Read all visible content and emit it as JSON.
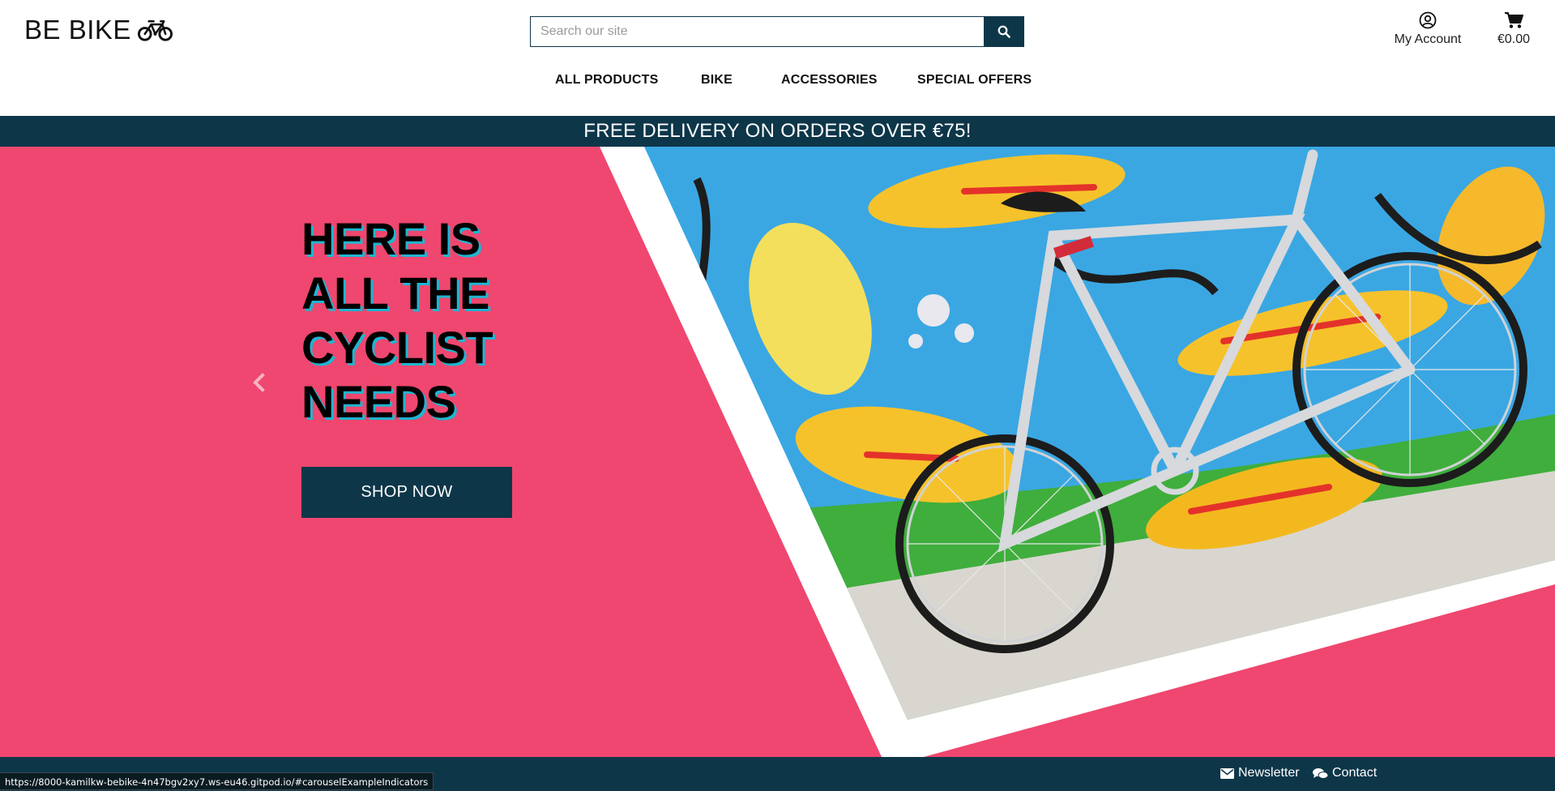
{
  "header": {
    "logo_text": "BE BIKE",
    "logo_icon": "bicycle-icon",
    "search": {
      "placeholder": "Search our site",
      "value": "",
      "button_icon": "search-icon"
    },
    "account": {
      "label": "My Account",
      "icon": "user-circle-icon"
    },
    "cart": {
      "total": "€0.00",
      "icon": "shopping-cart-icon"
    }
  },
  "nav": {
    "items": [
      {
        "label": "ALL PRODUCTS"
      },
      {
        "label": "BIKE"
      },
      {
        "label": "ACCESSORIES"
      },
      {
        "label": "SPECIAL OFFERS"
      }
    ]
  },
  "banner": {
    "text": "FREE DELIVERY ON ORDERS OVER €75!"
  },
  "hero": {
    "title_lines": [
      "HERE IS",
      "ALL THE",
      "CYCLIST",
      "NEEDS"
    ],
    "cta_label": "SHOP NOW",
    "prev_icon": "chevron-left-icon",
    "colors": {
      "background": "#ef476f",
      "title_shadow": "#1fb5d0",
      "dark": "#0e3649"
    }
  },
  "footer": {
    "newsletter": {
      "label": "Newsletter",
      "icon": "envelope-icon"
    },
    "contact": {
      "label": "Contact",
      "icon": "chat-icon"
    }
  },
  "status_bar": {
    "url": "https://8000-kamilkw-bebike-4n47bgv2xy7.ws-eu46.gitpod.io/#carouselExampleIndicators"
  }
}
